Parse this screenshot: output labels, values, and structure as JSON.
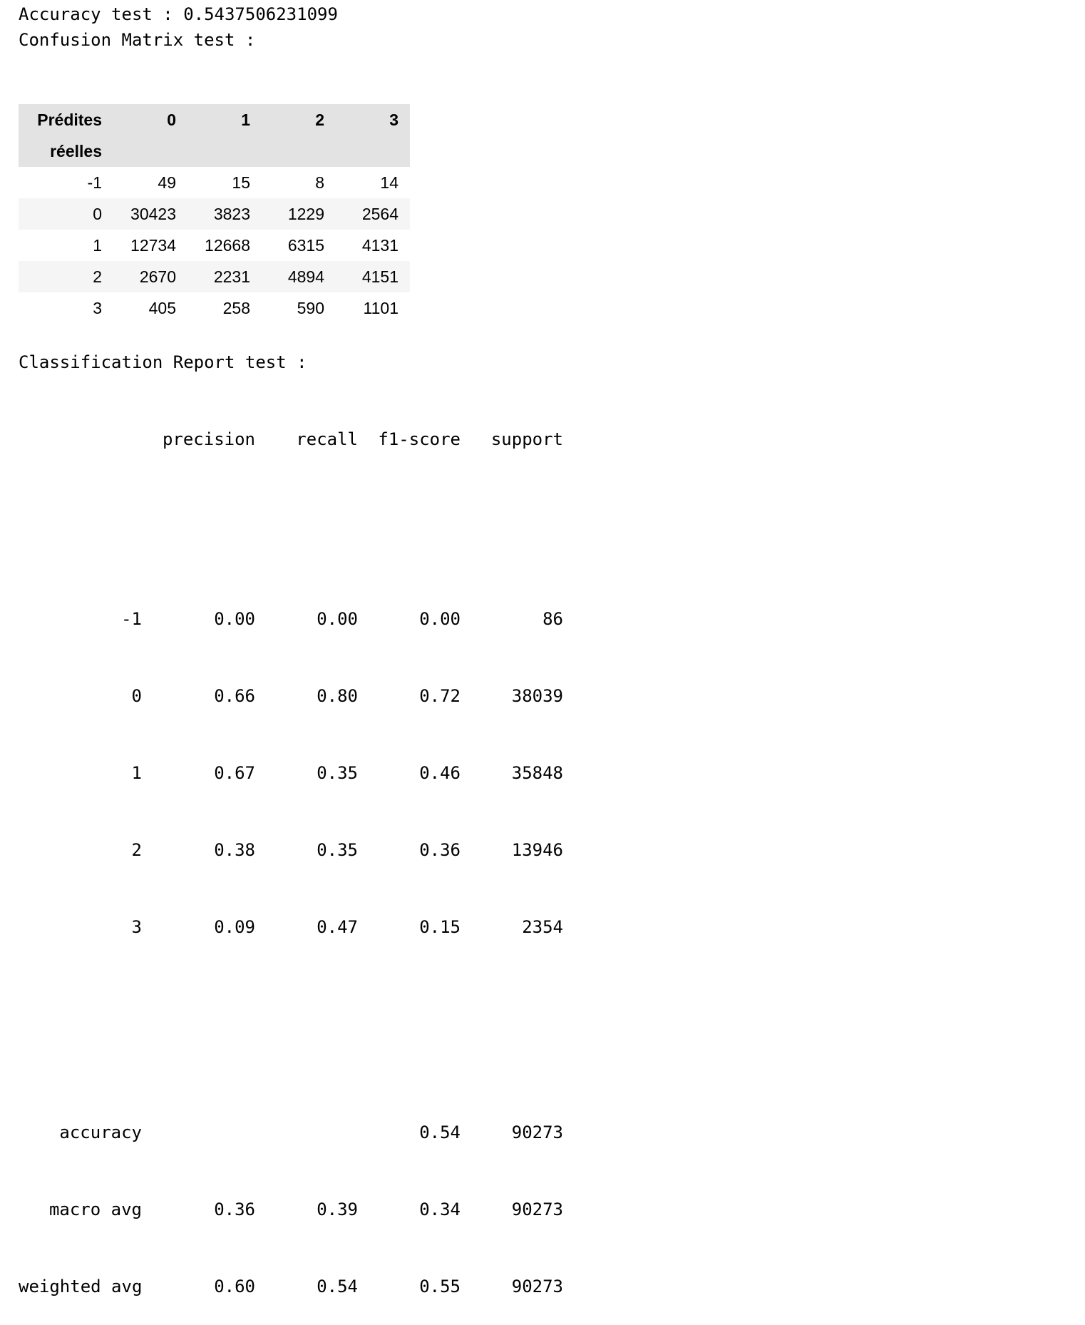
{
  "accuracy_line": "Accuracy test : 0.5437506231099",
  "confusion_title": "Confusion Matrix test :",
  "confusion_matrix": {
    "columns_name": "Prédites",
    "index_name": "réelles",
    "columns": [
      "0",
      "1",
      "2",
      "3"
    ],
    "rows": [
      {
        "label": "-1",
        "values": [
          "49",
          "15",
          "8",
          "14"
        ]
      },
      {
        "label": "0",
        "values": [
          "30423",
          "3823",
          "1229",
          "2564"
        ]
      },
      {
        "label": "1",
        "values": [
          "12734",
          "12668",
          "6315",
          "4131"
        ]
      },
      {
        "label": "2",
        "values": [
          "2670",
          "2231",
          "4894",
          "4151"
        ]
      },
      {
        "label": "3",
        "values": [
          "405",
          "258",
          "590",
          "1101"
        ]
      }
    ]
  },
  "report_title": "Classification Report test :",
  "report": {
    "headers": [
      "precision",
      "recall",
      "f1-score",
      "support"
    ],
    "class_rows": [
      {
        "label": "-1",
        "precision": "0.00",
        "recall": "0.00",
        "f1": "0.00",
        "support": "86"
      },
      {
        "label": "0",
        "precision": "0.66",
        "recall": "0.80",
        "f1": "0.72",
        "support": "38039"
      },
      {
        "label": "1",
        "precision": "0.67",
        "recall": "0.35",
        "f1": "0.46",
        "support": "35848"
      },
      {
        "label": "2",
        "precision": "0.38",
        "recall": "0.35",
        "f1": "0.36",
        "support": "13946"
      },
      {
        "label": "3",
        "precision": "0.09",
        "recall": "0.47",
        "f1": "0.15",
        "support": "2354"
      }
    ],
    "summary_rows": [
      {
        "label": "accuracy",
        "precision": "",
        "recall": "",
        "f1": "0.54",
        "support": "90273"
      },
      {
        "label": "macro avg",
        "precision": "0.36",
        "recall": "0.39",
        "f1": "0.34",
        "support": "90273"
      },
      {
        "label": "weighted avg",
        "precision": "0.60",
        "recall": "0.54",
        "f1": "0.55",
        "support": "90273"
      }
    ]
  }
}
